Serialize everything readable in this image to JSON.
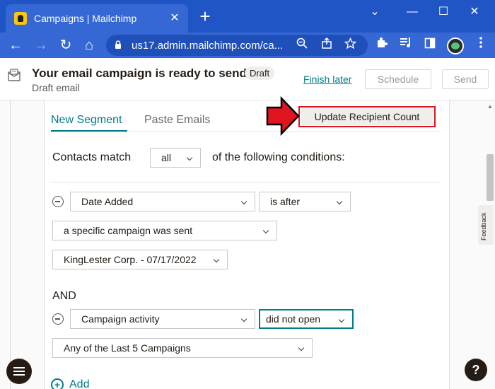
{
  "browser": {
    "tab_title": "Campaigns | Mailchimp",
    "tab_close": "✕",
    "new_tab": "+",
    "window_controls": {
      "minimize": "—",
      "maximize": "☐",
      "close": "✕",
      "collapse": "⌄"
    },
    "nav": {
      "back": "←",
      "forward": "→",
      "reload": "↻",
      "home": "⌂"
    },
    "url": "us17.admin.mailchimp.com/ca..."
  },
  "banner": {
    "title": "Your email campaign is ready to send!",
    "badge": "Draft",
    "subtitle": "Draft email",
    "finish_later": "Finish later",
    "schedule": "Schedule",
    "send": "Send"
  },
  "segment": {
    "tabs": {
      "new_segment": "New Segment",
      "paste_emails": "Paste Emails"
    },
    "update_button": "Update Recipient Count",
    "contacts_match_prefix": "Contacts match",
    "match_value": "all",
    "contacts_match_suffix": "of the following conditions:",
    "condition1": {
      "field": "Date Added",
      "operator": "is after",
      "mode": "a specific campaign was sent",
      "campaign": "KingLester Corp. - 07/17/2022"
    },
    "and_label": "AND",
    "condition2": {
      "field": "Campaign activity",
      "operator": "did not open",
      "range": "Any of the Last 5 Campaigns"
    },
    "add_label": "Add"
  },
  "feedback_label": "Feedback",
  "help_label": "?",
  "colors": {
    "accent": "#007c89",
    "annotation": "#e0141e",
    "chrome": "#1f55c4"
  }
}
